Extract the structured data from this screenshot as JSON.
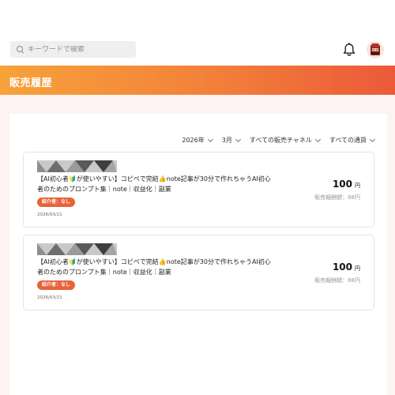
{
  "search": {
    "placeholder": "キーワードで検索",
    "icon": "search-icon"
  },
  "header": {
    "notification_icon": "bell-icon",
    "avatar_icon": "avatar"
  },
  "page": {
    "title": "販売履歴"
  },
  "filters": [
    {
      "label": "2026年"
    },
    {
      "label": "3月"
    },
    {
      "label": "すべての販売チャネル"
    },
    {
      "label": "すべての通貨"
    }
  ],
  "sales": [
    {
      "title": "【AI初心者🔰が使いやすい】コピペで完結👍note記事が30分で作れちゃうAI初心者のためのプロンプト集｜note｜収益化｜副業",
      "badge": "紹介者：なし",
      "date": "2026/03/21",
      "price": "100",
      "currency": "円",
      "reward": "販売報酬額：88円"
    },
    {
      "title": "【AI初心者🔰が使いやすい】コピペで完結👍note記事が30分で作れちゃうAI初心者のためのプロンプト集｜note｜収益化｜副業",
      "badge": "紹介者：なし",
      "date": "2026/03/21",
      "price": "100",
      "currency": "円",
      "reward": "販売報酬額：88円"
    }
  ],
  "colors": {
    "accent": "#e8633a",
    "banner_start": "#f7a23a",
    "banner_end": "#ea5a3a",
    "page_bg": "#fdf3f3"
  }
}
